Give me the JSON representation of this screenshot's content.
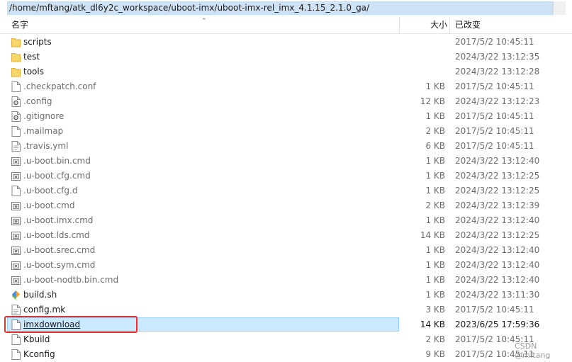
{
  "path_bar": {
    "path": "/home/mftang/atk_dl6y2c_workspace/uboot-imx/uboot-imx-rel_imx_4.1.15_2.1.0_ga/"
  },
  "columns": {
    "name": "名字",
    "size": "大小",
    "date": "已改变"
  },
  "rows": [
    {
      "name": "scripts",
      "size": "",
      "date": "2017/5/2 10:45:11",
      "icon": "folder-icon"
    },
    {
      "name": "test",
      "size": "",
      "date": "2024/3/22 13:12:35",
      "icon": "folder-icon"
    },
    {
      "name": "tools",
      "size": "",
      "date": "2024/3/22 13:12:28",
      "icon": "folder-icon"
    },
    {
      "name": ".checkpatch.conf",
      "size": "1 KB",
      "date": "2017/5/2 10:45:11",
      "icon": "file-icon"
    },
    {
      "name": ".config",
      "size": "12 KB",
      "date": "2024/3/22 13:12:23",
      "icon": "config-file-icon"
    },
    {
      "name": ".gitignore",
      "size": "1 KB",
      "date": "2017/5/2 10:45:11",
      "icon": "config-file-icon"
    },
    {
      "name": ".mailmap",
      "size": "2 KB",
      "date": "2017/5/2 10:45:11",
      "icon": "file-icon"
    },
    {
      "name": ".travis.yml",
      "size": "6 KB",
      "date": "2017/5/2 10:45:11",
      "icon": "text-file-icon"
    },
    {
      "name": ".u-boot.bin.cmd",
      "size": "1 KB",
      "date": "2024/3/22 13:12:40",
      "icon": "cmd-file-icon"
    },
    {
      "name": ".u-boot.cfg.cmd",
      "size": "1 KB",
      "date": "2024/3/22 13:12:25",
      "icon": "cmd-file-icon"
    },
    {
      "name": ".u-boot.cfg.d",
      "size": "1 KB",
      "date": "2024/3/22 13:12:25",
      "icon": "file-icon"
    },
    {
      "name": ".u-boot.cmd",
      "size": "2 KB",
      "date": "2024/3/22 13:12:39",
      "icon": "cmd-file-icon"
    },
    {
      "name": ".u-boot.imx.cmd",
      "size": "1 KB",
      "date": "2024/3/22 13:12:40",
      "icon": "cmd-file-icon"
    },
    {
      "name": ".u-boot.lds.cmd",
      "size": "14 KB",
      "date": "2024/3/22 13:12:25",
      "icon": "cmd-file-icon"
    },
    {
      "name": ".u-boot.srec.cmd",
      "size": "1 KB",
      "date": "2024/3/22 13:12:40",
      "icon": "cmd-file-icon"
    },
    {
      "name": ".u-boot.sym.cmd",
      "size": "1 KB",
      "date": "2024/3/22 13:12:40",
      "icon": "cmd-file-icon"
    },
    {
      "name": ".u-boot-nodtb.bin.cmd",
      "size": "1 KB",
      "date": "2024/3/22 13:12:40",
      "icon": "cmd-file-icon"
    },
    {
      "name": "build.sh",
      "size": "1 KB",
      "date": "2024/3/22 13:11:30",
      "icon": "script-file-icon"
    },
    {
      "name": "config.mk",
      "size": "3 KB",
      "date": "2017/5/2 10:45:11",
      "icon": "text-file-icon"
    },
    {
      "name": "imxdownload",
      "size": "14 KB",
      "date": "2023/6/25 17:59:36",
      "icon": "file-icon",
      "selected": true
    },
    {
      "name": "Kbuild",
      "size": "2 KB",
      "date": "2017/5/2 10:45:11",
      "icon": "file-icon"
    },
    {
      "name": "Kconfig",
      "size": "9 KB",
      "date": "2017/5/2 10:45:11",
      "icon": "file-icon"
    }
  ],
  "watermark": "CSDN @mftang",
  "colors": {
    "selection": "#cce8ff",
    "highlight_box": "#e8302a",
    "folder": "#f6d56b"
  }
}
